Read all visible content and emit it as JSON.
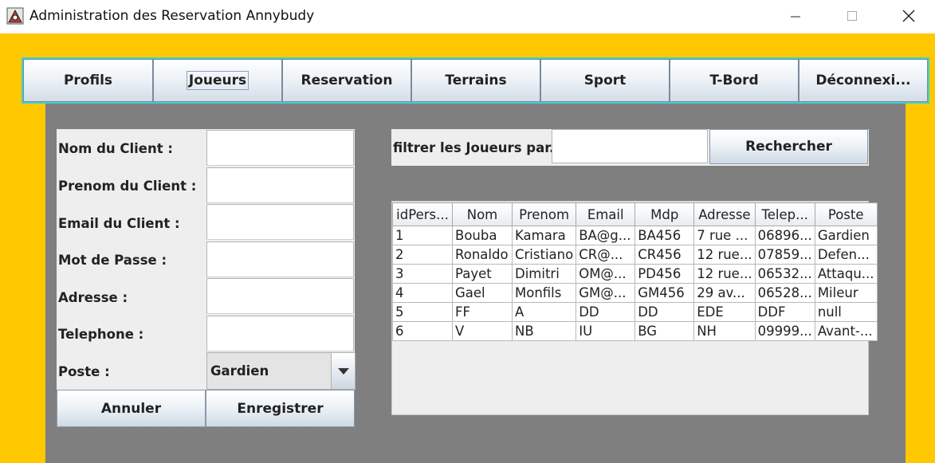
{
  "window": {
    "title": "Administration des Reservation Annybudy"
  },
  "tabs": [
    {
      "label": "Profils"
    },
    {
      "label": "Joueurs"
    },
    {
      "label": "Reservation"
    },
    {
      "label": "Terrains"
    },
    {
      "label": "Sport"
    },
    {
      "label": "T-Bord"
    },
    {
      "label": "Déconnexi..."
    }
  ],
  "active_tab": "Joueurs",
  "form": {
    "nom_label": "Nom du Client :",
    "prenom_label": "Prenom du Client :",
    "email_label": "Email du Client :",
    "mdp_label": "Mot de Passe :",
    "adresse_label": "Adresse :",
    "telephone_label": "Telephone :",
    "poste_label": "Poste :",
    "poste_value": "Gardien",
    "nom_value": "",
    "prenom_value": "",
    "email_value": "",
    "mdp_value": "",
    "adresse_value": "",
    "telephone_value": "",
    "annuler_label": "Annuler",
    "enregistrer_label": "Enregistrer"
  },
  "filter": {
    "label": "filtrer les Joueurs par...",
    "value": "",
    "search_label": "Rechercher"
  },
  "table": {
    "headers": [
      "idPers...",
      "Nom",
      "Prenom",
      "Email",
      "Mdp",
      "Adresse",
      "Telep...",
      "Poste"
    ],
    "rows": [
      [
        "1",
        "Bouba",
        "Kamara",
        "BA@g...",
        "BA456",
        "7 rue ...",
        "06896...",
        "Gardien"
      ],
      [
        "2",
        "Ronaldo",
        "Cristiano",
        "CR@...",
        "CR456",
        "12 rue...",
        "07859...",
        "Defen..."
      ],
      [
        "3",
        "Payet",
        "Dimitri",
        "OM@...",
        "PD456",
        "12 rue...",
        "06532...",
        "Attaqu..."
      ],
      [
        "4",
        "Gael",
        "Monfils",
        "GM@...",
        "GM456",
        "29 av...",
        "06528...",
        "Mileur"
      ],
      [
        "5",
        "FF",
        "A",
        "DD",
        "DD",
        "EDE",
        "DDF",
        "null"
      ],
      [
        "6",
        "V",
        "NB",
        "IU",
        "BG",
        "NH",
        "09999...",
        "Avant-..."
      ]
    ]
  },
  "colors": {
    "frame_bg": "#ffc800",
    "panel_bg": "#7f7f7f",
    "tabbar_border": "#3fd0d0"
  }
}
